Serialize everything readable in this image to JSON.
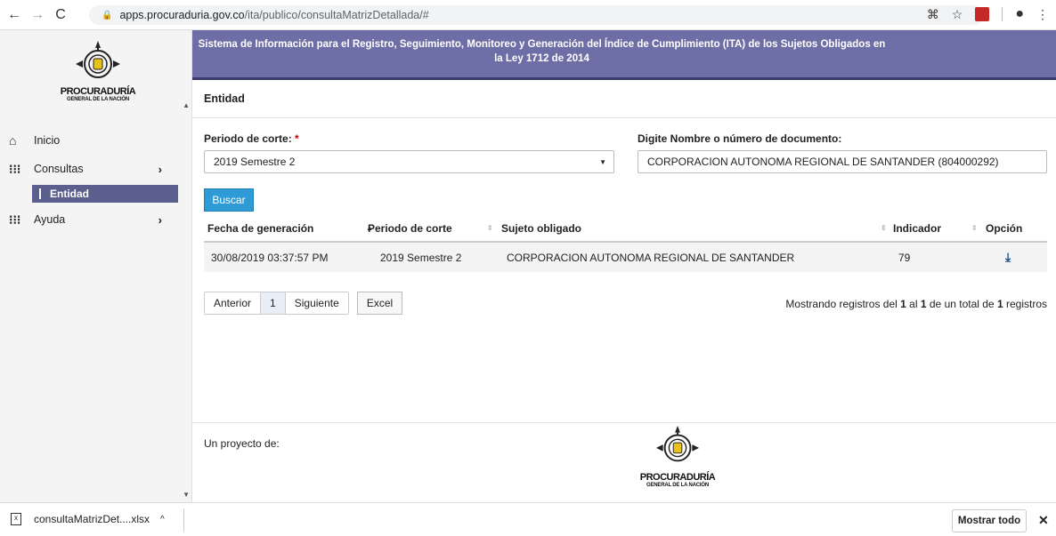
{
  "browser": {
    "url_host": "apps.procuraduria.gov.co",
    "url_path": "/ita/publico/consultaMatrizDetallada/#"
  },
  "logo": {
    "line1": "PROCURADURÍA",
    "line2": "GENERAL DE LA NACIÓN"
  },
  "sidebar": {
    "items": [
      {
        "label": "Inicio",
        "icon": "home-icon"
      },
      {
        "label": "Consultas",
        "icon": "grid-icon"
      },
      {
        "label": "Entidad"
      },
      {
        "label": "Ayuda",
        "icon": "grid-icon"
      }
    ]
  },
  "header": {
    "title_line1": "Sistema de Información para el Registro, Seguimiento, Monitoreo y Generación del Índice de Cumplimiento (ITA) de los Sujetos Obligados en",
    "title_line2": "la Ley 1712 de 2014"
  },
  "main": {
    "section_title": "Entidad",
    "periodo_label": "Periodo de corte:",
    "periodo_required": "*",
    "periodo_value": "2019 Semestre 2",
    "doc_label": "Digite Nombre o número de documento:",
    "doc_value": "CORPORACION AUTONOMA REGIONAL DE SANTANDER (804000292)",
    "buscar_label": "Buscar"
  },
  "table": {
    "headers": [
      "Fecha de generación",
      "Periodo de corte",
      "Sujeto obligado",
      "Indicador",
      "Opción"
    ],
    "rows": [
      [
        "30/08/2019 03:37:57 PM",
        "2019 Semestre 2",
        "CORPORACION AUTONOMA REGIONAL DE SANTANDER",
        "79"
      ]
    ]
  },
  "pager": {
    "prev": "Anterior",
    "page": "1",
    "next": "Siguiente",
    "excel": "Excel"
  },
  "info": {
    "prefix": "Mostrando registros del ",
    "from": "1",
    "mid1": " al ",
    "to": "1",
    "mid2": " de un total de ",
    "total": "1",
    "suffix": " registros"
  },
  "footer": {
    "text": "Un proyecto de:"
  },
  "downloads": {
    "file": "consultaMatrizDet....xlsx",
    "show_all": "Mostrar todo"
  }
}
